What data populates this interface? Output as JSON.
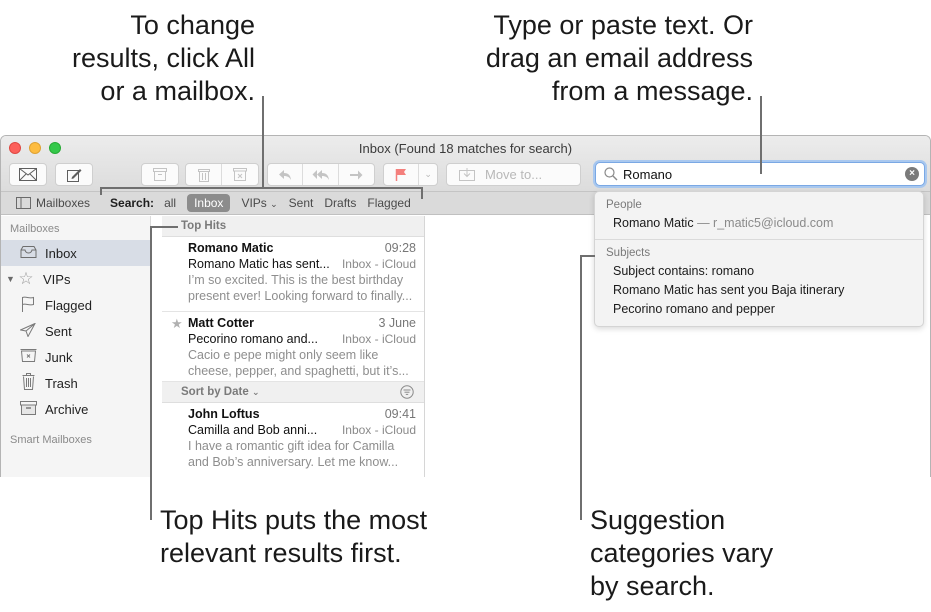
{
  "callouts": {
    "top_left": [
      "To change",
      "results, click All",
      "or a mailbox."
    ],
    "top_right": [
      "Type or paste text. Or",
      "drag an email address",
      "from a message."
    ],
    "bottom_left": [
      "Top Hits puts the most",
      "relevant results first."
    ],
    "bottom_right": [
      "Suggestion",
      "categories vary",
      "by search."
    ]
  },
  "window": {
    "title": "Inbox (Found 18 matches for search)"
  },
  "toolbar": {
    "get_mail_icon": "envelope-icon",
    "compose_icon": "compose-icon",
    "archive_icon": "archive-icon",
    "delete_icon": "trash-icon",
    "junk_icon": "junk-icon",
    "reply_icon": "reply-icon",
    "reply_all_icon": "reply-all-icon",
    "forward_icon": "forward-icon",
    "flag_icon": "flag-icon",
    "flag_color": "#f47f7c",
    "move_to_label": "Move to..."
  },
  "search": {
    "value": "Romano"
  },
  "scopebar": {
    "mailboxes_label": "Mailboxes",
    "search_label": "Search:",
    "scopes": [
      "all",
      "Inbox",
      "VIPs",
      "Sent",
      "Drafts",
      "Flagged"
    ],
    "selected": "Inbox"
  },
  "sidebar": {
    "heading": "Mailboxes",
    "items": [
      {
        "label": "Inbox",
        "icon": "inbox-icon",
        "selected": true
      },
      {
        "label": "VIPs",
        "icon": "star-icon"
      },
      {
        "label": "Flagged",
        "icon": "flag-icon"
      },
      {
        "label": "Sent",
        "icon": "paper-plane-icon"
      },
      {
        "label": "Junk",
        "icon": "junk-icon"
      },
      {
        "label": "Trash",
        "icon": "trash-icon"
      },
      {
        "label": "Archive",
        "icon": "archive-icon"
      }
    ],
    "smart_heading": "Smart Mailboxes"
  },
  "message_list": {
    "top_hits_label": "Top Hits",
    "sort_label": "Sort by Date",
    "top_hits": [
      {
        "from": "Romano Matic",
        "date": "09:28",
        "subject": "Romano Matic has sent...",
        "mailbox": "Inbox - iCloud",
        "preview": [
          "I’m so excited. This is the best birthday",
          "present ever! Looking forward to finally..."
        ],
        "starred": false
      },
      {
        "from": "Matt Cotter",
        "date": "3 June",
        "subject": "Pecorino romano and...",
        "mailbox": "Inbox - iCloud",
        "preview": [
          "Cacio e pepe might only seem like",
          "cheese, pepper, and spaghetti, but it’s..."
        ],
        "starred": true
      }
    ],
    "by_date": [
      {
        "from": "John Loftus",
        "date": "09:41",
        "subject": "Camilla and Bob anni...",
        "mailbox": "Inbox - iCloud",
        "preview": [
          "I have a romantic gift idea for Camilla",
          "and Bob’s anniversary. Let me know..."
        ]
      }
    ]
  },
  "suggestions": {
    "people_heading": "People",
    "people": [
      {
        "name": "Romano Matic",
        "sep": " — ",
        "email": "r_matic5@icloud.com"
      }
    ],
    "subjects_heading": "Subjects",
    "subjects": [
      "Subject contains: romano",
      "Romano Matic has sent you Baja itinerary",
      "Pecorino romano and pepper"
    ]
  }
}
